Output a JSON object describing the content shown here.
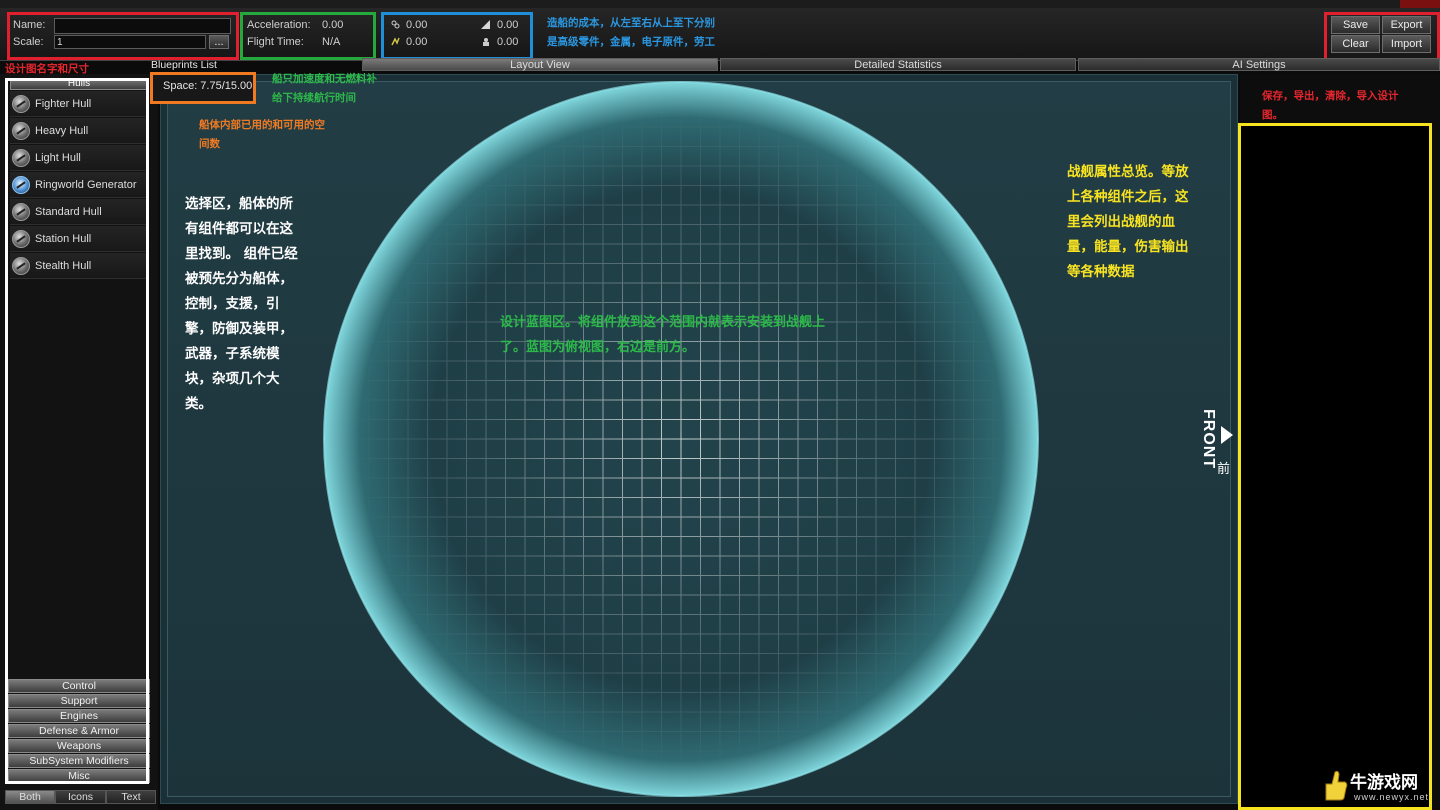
{
  "header": {
    "name_label": "Name:",
    "name_value": "",
    "scale_label": "Scale:",
    "scale_value": "1",
    "browse_label": "...",
    "acceleration_label": "Acceleration:",
    "acceleration_value": "0.00",
    "flight_time_label": "Flight Time:",
    "flight_time_value": "N/A",
    "costs": [
      {
        "icon": "advanced-parts-icon",
        "value": "0.00"
      },
      {
        "icon": "metal-icon",
        "value": "0.00"
      },
      {
        "icon": "electronics-icon",
        "value": "0.00"
      },
      {
        "icon": "labor-icon",
        "value": "0.00"
      }
    ],
    "actions": {
      "save": "Save",
      "export": "Export",
      "clear": "Clear",
      "import": "Import"
    }
  },
  "sidebar": {
    "blueprints_list_label": "Blueprints List",
    "space_label": "Space: 7.75/15.00",
    "hulls_header": "Hulls",
    "hulls": [
      {
        "label": "Fighter Hull",
        "icon": "hull-icon"
      },
      {
        "label": "Heavy Hull",
        "icon": "hull-icon"
      },
      {
        "label": "Light Hull",
        "icon": "hull-icon"
      },
      {
        "label": "Ringworld Generator",
        "icon": "ringworld-icon"
      },
      {
        "label": "Standard Hull",
        "icon": "hull-icon"
      },
      {
        "label": "Station Hull",
        "icon": "hull-icon"
      },
      {
        "label": "Stealth Hull",
        "icon": "hull-icon"
      }
    ],
    "categories": [
      "Control",
      "Support",
      "Engines",
      "Defense & Armor",
      "Weapons",
      "SubSystem Modifiers",
      "Misc"
    ],
    "view_modes": [
      "Both",
      "Icons",
      "Text"
    ]
  },
  "tabs": [
    {
      "label": "Layout View",
      "active": true
    },
    {
      "label": "Detailed Statistics",
      "active": false
    },
    {
      "label": "AI Settings",
      "active": false
    }
  ],
  "canvas": {
    "front_label": "FRONT",
    "front_cn": "前"
  },
  "annotations": {
    "name_scale": "设计图名字和尺寸",
    "accel": "船只加速度和无燃料补\n给下持续航行时间",
    "cost": "造船的成本，从左至右从上至下分别\n是高级零件，金属，电子原件，劳工",
    "actions": "保存，导出，清除，导入设计\n图。",
    "space": "船体内部已用的和可用的空\n间数",
    "selection": "选择区，船体的所\n有组件都可以在这\n里找到。 组件已经\n被预先分为船体，\n控制，支援，引\n擎，防御及装甲，\n武器，子系统模\n块，杂项几个大\n类。",
    "blueprint": "设计蓝图区。将组件放到这个范围内就表示安装到战舰上\n了。蓝图为俯视图，右边是前方。",
    "stats": "战舰属性总览。等放\n上各种组件之后，这\n里会列出战舰的血\n量，能量，伤害输出\n等各种数据"
  },
  "watermark": {
    "text": "牛游戏网",
    "url": "www.newyx.net"
  },
  "colors": {
    "red": "#e0202e",
    "green": "#25a83c",
    "blue": "#1e8fd8",
    "orange": "#f07a22",
    "white": "#ffffff",
    "yellow": "#f6e51e",
    "grid_cyan": "#7fd6dc"
  }
}
